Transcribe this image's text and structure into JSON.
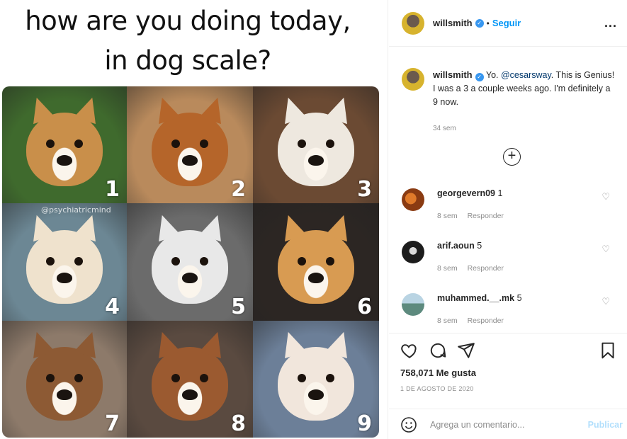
{
  "meme": {
    "title_line1": "how are you doing today,",
    "title_line2": "in dog scale?",
    "watermark": "@psychiatricmind",
    "tiles": [
      {
        "num": "1",
        "bg": "#3f6a2d",
        "fur": "#c98f4a",
        "icon": "shiba-in-hoodie"
      },
      {
        "num": "2",
        "bg": "#b98a5c",
        "fur": "#b5652a",
        "icon": "derpy-dog-face"
      },
      {
        "num": "3",
        "bg": "#6b4a33",
        "fur": "#eee8df",
        "icon": "white-dog-grin"
      },
      {
        "num": "4",
        "bg": "#6c8794",
        "fur": "#efe2cd",
        "icon": "chihuahua-smile"
      },
      {
        "num": "5",
        "bg": "#6b6b6b",
        "fur": "#e8e8e8",
        "icon": "husky-squint"
      },
      {
        "num": "6",
        "bg": "#2c2623",
        "fur": "#d89b52",
        "icon": "shiba-smile"
      },
      {
        "num": "7",
        "bg": "#8d7a6a",
        "fur": "#8d5a34",
        "icon": "chihuahua-earbuds"
      },
      {
        "num": "8",
        "bg": "#5a4a40",
        "fur": "#9b5a30",
        "icon": "sad-dog-blanket"
      },
      {
        "num": "9",
        "bg": "#6c7f98",
        "fur": "#f1e6dc",
        "icon": "happy-fluffy-dog"
      }
    ]
  },
  "header": {
    "username": "willsmith",
    "dot": "•",
    "follow": "Seguir",
    "more": "..."
  },
  "caption": {
    "username": "willsmith",
    "text_pre": "Yo. ",
    "mention": "@cesarsway",
    "text_post": ". This is Genius! I was a 3 a couple weeks ago. I'm definitely a 9 now.",
    "time": "34 sem"
  },
  "comments": [
    {
      "name": "georgevern09",
      "text": "1",
      "time": "8 sem",
      "reply": "Responder",
      "avatar_color": "#8a3b12"
    },
    {
      "name": "arif.aoun",
      "text": "5",
      "time": "8 sem",
      "reply": "Responder",
      "avatar_color": "#1c1c1c"
    },
    {
      "name": "muhammed.__.mk",
      "text": "5",
      "time": "8 sem",
      "reply": "Responder",
      "avatar_color": "#5d8a7e"
    }
  ],
  "actions": {
    "likes": "758,071 Me gusta",
    "date": "1 DE AGOSTO DE 2020",
    "comment_placeholder": "Agrega un comentario...",
    "publish": "Publicar"
  },
  "colors": {
    "accent": "#0095f6",
    "verified": "#3897f0",
    "muted": "#8e8e8e"
  }
}
